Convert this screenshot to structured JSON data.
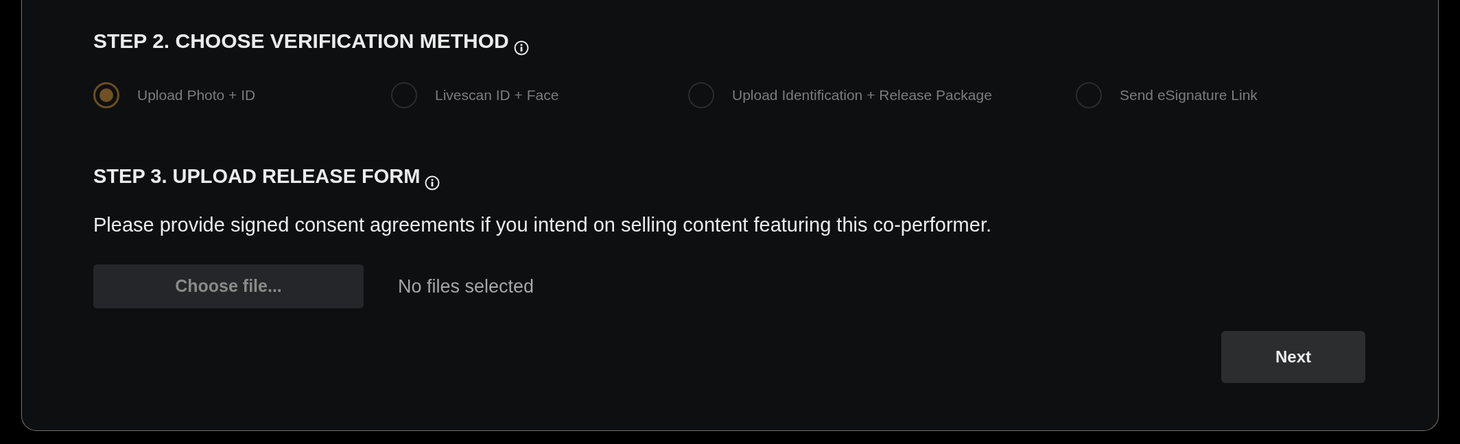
{
  "step2": {
    "title": "STEP 2. CHOOSE VERIFICATION METHOD",
    "options": [
      {
        "label": "Upload Photo + ID",
        "selected": true
      },
      {
        "label": "Livescan ID + Face",
        "selected": false
      },
      {
        "label": "Upload Identification + Release Package",
        "selected": false
      },
      {
        "label": "Send eSignature Link",
        "selected": false
      }
    ]
  },
  "step3": {
    "title": "STEP 3. UPLOAD RELEASE FORM",
    "description": "Please provide signed consent agreements if you intend on selling content featuring this co-performer.",
    "file_button": "Choose file...",
    "file_status": "No files selected"
  },
  "next_button": "Next"
}
